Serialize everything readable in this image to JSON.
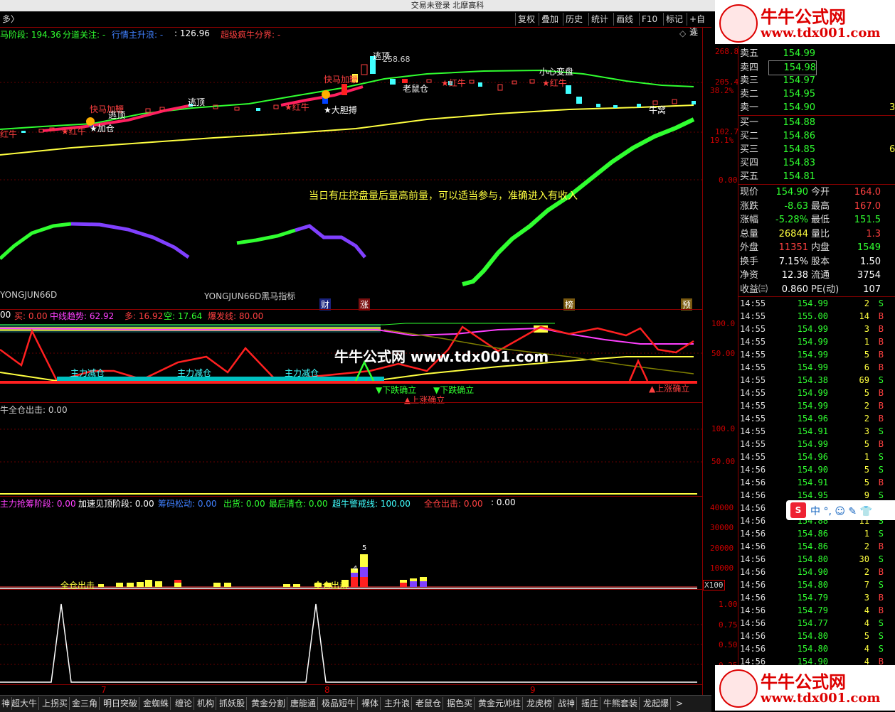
{
  "window": {
    "title": "交易未登录 北摩高科"
  },
  "toolbar": {
    "left_label": "多〉",
    "buttons": [
      "复权",
      "叠加",
      "历史",
      "统计",
      "画线",
      "F10",
      "标记",
      "+自选"
    ]
  },
  "colors": {
    "red": "#ff2020",
    "green": "#30ff30",
    "yellow": "#ffff40",
    "cyan": "#40ffff",
    "magenta": "#ff40ff",
    "purple": "#8040ff",
    "white": "#ffffff"
  },
  "main_indicators": [
    {
      "text": "马阶段: 194.36",
      "color": "#30ff30"
    },
    {
      "text": "分道关注: -",
      "color": "#30ff30"
    },
    {
      "text": "行情主升浪: -",
      "color": "#4080ff"
    },
    {
      "text": ": 126.96",
      "color": "#ffffff"
    },
    {
      "text": "超级疯牛分界: -",
      "color": "#ff4040"
    }
  ],
  "main_axis": [
    "268.8",
    "205.4",
    "38.2%",
    "102.7",
    "19.1%",
    "0.00"
  ],
  "chart_labels": {
    "kuaima1": "快马加鞭",
    "kuaima2": "快马加鞭",
    "taoding1": "逃顶",
    "taoding2": "逃顶",
    "taoding3": "逃顶",
    "jiacang": "★加仓",
    "hongniu1": "★红牛",
    "hongniu2": "★红牛",
    "hongniu3": "★红牛",
    "hongniu4": "★红牛",
    "hongniu0": "红牛",
    "dadanbo": "★大胆搏",
    "laoshucang": "老鼠仓",
    "xiaoxin": "小心变盘",
    "hiprice": "258.68",
    "niuwo": "牛窝"
  },
  "notice": "当日有庄控盘量后量高前量，可以适当参与，准确进入有收入",
  "indicator_name_1": "YONGJUN66D",
  "indicator_name_2": "YONGJUN66D黑马指标",
  "tags": [
    "财",
    "涨",
    "榜",
    "预"
  ],
  "watermark": "牛牛公式网 www.tdx001.com",
  "panel2": {
    "indicators": [
      {
        "text": "00",
        "color": "#ffffff"
      },
      {
        "text": "买: 0.00",
        "color": "#ff4040"
      },
      {
        "text": "中线趋势: 62.92",
        "color": "#ff40ff"
      },
      {
        "text": "多: 16.92",
        "color": "#ff4040"
      },
      {
        "text": "空: 17.64",
        "color": "#30ff30"
      },
      {
        "text": "爆发线: 80.00",
        "color": "#ff4040"
      }
    ],
    "axis": [
      "100.0",
      "50.00"
    ],
    "labels": {
      "jc1": "主力减仓",
      "jc2": "主力减仓",
      "jc3": "主力减仓",
      "xd1": "▼下跌确立",
      "xd2": "▼下跌确立",
      "sz1": "▲上涨确立",
      "sz2": "▲上涨确立"
    }
  },
  "panel3": {
    "indicator": "牛全仓出击: 0.00",
    "axis": [
      "100.0",
      "50.00"
    ]
  },
  "panel4": {
    "indicators": [
      {
        "text": "主力抢筹阶段: 0.00",
        "color": "#ff40ff"
      },
      {
        "text": "加速见顶阶段: 0.00",
        "color": "#ffffff"
      },
      {
        "text": "筹码松动: 0.00",
        "color": "#4080ff"
      },
      {
        "text": "出货: 0.00",
        "color": "#30ff30"
      },
      {
        "text": "最后清仓: 0.00",
        "color": "#30ff30"
      },
      {
        "text": "超牛警戒线: 100.00",
        "color": "#40ffff"
      },
      {
        "text": "全仓出击: 0.00",
        "color": "#ff4040"
      },
      {
        "text": ": 0.00",
        "color": "#ffffff"
      }
    ],
    "axis": [
      "40000",
      "30000",
      "20000",
      "10000"
    ],
    "x100": "X100",
    "labels": {
      "qc1": "全仓出击",
      "qc2": "全仓出击",
      "n4": "4",
      "n5": "5"
    }
  },
  "panel5": {
    "axis": [
      "1.00",
      "0.75",
      "0.50",
      "0.25"
    ]
  },
  "dates": [
    "7",
    "8",
    "9"
  ],
  "sell_book": [
    {
      "label": "卖五",
      "price": "154.99",
      "vol": ""
    },
    {
      "label": "卖四",
      "price": "154.98",
      "vol": ""
    },
    {
      "label": "卖三",
      "price": "154.97",
      "vol": ""
    },
    {
      "label": "卖二",
      "price": "154.95",
      "vol": ""
    },
    {
      "label": "卖一",
      "price": "154.90",
      "vol": "3"
    }
  ],
  "buy_book": [
    {
      "label": "买一",
      "price": "154.88",
      "vol": ""
    },
    {
      "label": "买二",
      "price": "154.86",
      "vol": ""
    },
    {
      "label": "买三",
      "price": "154.85",
      "vol": "6"
    },
    {
      "label": "买四",
      "price": "154.83",
      "vol": ""
    },
    {
      "label": "买五",
      "price": "154.81",
      "vol": ""
    }
  ],
  "stats": [
    {
      "l1": "现价",
      "v1": "154.90",
      "c1": "#30ff30",
      "l2": "今开",
      "v2": "164.0",
      "c2": "#ff4040"
    },
    {
      "l1": "涨跌",
      "v1": "-8.63",
      "c1": "#30ff30",
      "l2": "最高",
      "v2": "167.0",
      "c2": "#ff4040"
    },
    {
      "l1": "涨幅",
      "v1": "-5.28%",
      "c1": "#30ff30",
      "l2": "最低",
      "v2": "151.5",
      "c2": "#30ff30"
    },
    {
      "l1": "总量",
      "v1": "26844",
      "c1": "#ffff40",
      "l2": "量比",
      "v2": "1.3",
      "c2": "#ff4040"
    },
    {
      "l1": "外盘",
      "v1": "11351",
      "c1": "#ff4040",
      "l2": "内盘",
      "v2": "1549",
      "c2": "#30ff30"
    },
    {
      "l1": "换手",
      "v1": "7.15%",
      "c1": "#ffffff",
      "l2": "股本",
      "v2": "1.50",
      "c2": "#ffffff"
    },
    {
      "l1": "净资",
      "v1": "12.38",
      "c1": "#ffffff",
      "l2": "流通",
      "v2": "3754",
      "c2": "#ffffff"
    },
    {
      "l1": "收益㈢",
      "v1": "0.860",
      "c1": "#ffffff",
      "l2": "PE(动)",
      "v2": "107",
      "c2": "#ffffff"
    }
  ],
  "ticks": [
    {
      "t": "14:55",
      "p": "154.99",
      "v": "2",
      "s": "S"
    },
    {
      "t": "14:55",
      "p": "155.00",
      "v": "14",
      "s": "B"
    },
    {
      "t": "14:55",
      "p": "154.99",
      "v": "3",
      "s": "B"
    },
    {
      "t": "14:55",
      "p": "154.99",
      "v": "1",
      "s": "B"
    },
    {
      "t": "14:55",
      "p": "154.99",
      "v": "5",
      "s": "B"
    },
    {
      "t": "14:55",
      "p": "154.99",
      "v": "6",
      "s": "B"
    },
    {
      "t": "14:55",
      "p": "154.38",
      "v": "69",
      "s": "S"
    },
    {
      "t": "14:55",
      "p": "154.99",
      "v": "5",
      "s": "B"
    },
    {
      "t": "14:55",
      "p": "154.99",
      "v": "2",
      "s": "B"
    },
    {
      "t": "14:55",
      "p": "154.96",
      "v": "2",
      "s": "B"
    },
    {
      "t": "14:55",
      "p": "154.91",
      "v": "3",
      "s": "S"
    },
    {
      "t": "14:55",
      "p": "154.99",
      "v": "5",
      "s": "B"
    },
    {
      "t": "14:55",
      "p": "154.96",
      "v": "1",
      "s": "S"
    },
    {
      "t": "14:56",
      "p": "154.90",
      "v": "5",
      "s": "S"
    },
    {
      "t": "14:56",
      "p": "154.91",
      "v": "5",
      "s": "B"
    },
    {
      "t": "14:56",
      "p": "154.95",
      "v": "9",
      "s": "S"
    },
    {
      "t": "14:56",
      "p": "",
      "v": "",
      "s": ""
    },
    {
      "t": "14:56",
      "p": "154.88",
      "v": "11",
      "s": "S"
    },
    {
      "t": "14:56",
      "p": "154.86",
      "v": "1",
      "s": "S"
    },
    {
      "t": "14:56",
      "p": "154.86",
      "v": "2",
      "s": "B"
    },
    {
      "t": "14:56",
      "p": "154.80",
      "v": "30",
      "s": "S"
    },
    {
      "t": "14:56",
      "p": "154.90",
      "v": "2",
      "s": "B"
    },
    {
      "t": "14:56",
      "p": "154.80",
      "v": "7",
      "s": "S"
    },
    {
      "t": "14:56",
      "p": "154.79",
      "v": "3",
      "s": "B"
    },
    {
      "t": "14:56",
      "p": "154.79",
      "v": "4",
      "s": "B"
    },
    {
      "t": "14:56",
      "p": "154.77",
      "v": "4",
      "s": "S"
    },
    {
      "t": "14:56",
      "p": "154.80",
      "v": "5",
      "s": "S"
    },
    {
      "t": "14:56",
      "p": "154.80",
      "v": "4",
      "s": "S"
    },
    {
      "t": "14:56",
      "p": "154.90",
      "v": "4",
      "s": "B"
    }
  ],
  "bottom_tabs": [
    "神",
    "超大牛",
    "上拐买",
    "金三角",
    "明日突破",
    "金蜘蛛",
    "缠论",
    "机构",
    "抓妖股",
    "黄金分割",
    "唐能通",
    "极品短牛",
    "裸体",
    "主升浪",
    "老鼠仓",
    "据色买",
    "黄金元帅柱",
    "龙虎榜",
    "战神",
    "摇庄",
    "牛熊套装",
    "龙起爆"
  ],
  "logo": {
    "line1": "牛牛公式网",
    "line2": "www.tdx001.com"
  },
  "ime": {
    "s_label": "S",
    "items": "中 °,  ☺  ✎  👕"
  }
}
